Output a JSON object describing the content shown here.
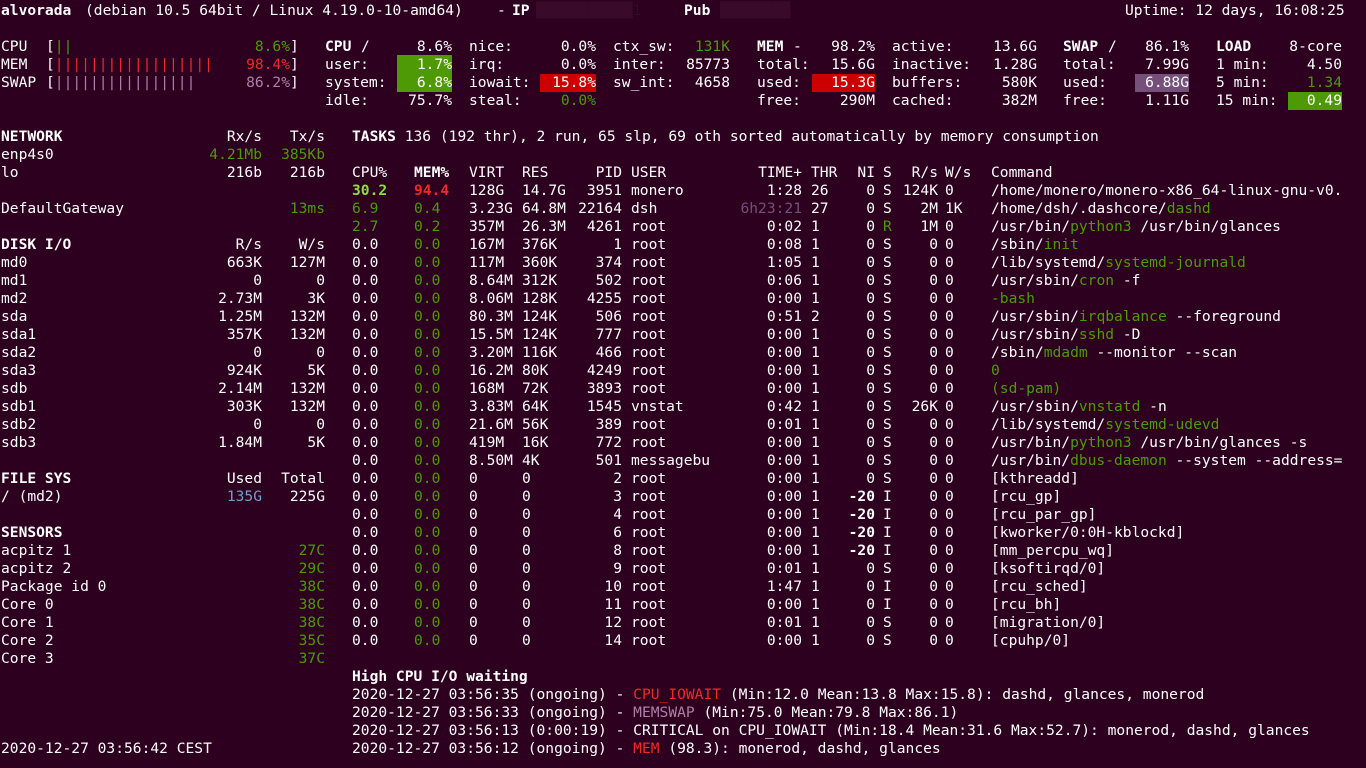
{
  "header": {
    "host": "alvorada",
    "sys": "(debian 10.5 64bit / Linux 4.19.0-10-amd64)",
    "ip_label": "IP",
    "ip_redacted": "███████████1",
    "pub_label": "Pub",
    "pub_redacted": "████████",
    "uptime": "Uptime: 12 days, 16:08:25"
  },
  "quicklook": {
    "cpu": {
      "label": "CPU",
      "bar": "||",
      "pct": "8.6%"
    },
    "mem": {
      "label": "MEM",
      "bar": "||||||||||||||||||",
      "pct": "98.4%"
    },
    "swap": {
      "label": "SWAP",
      "bar": "||||||||||||||||",
      "pct": "86.2%"
    }
  },
  "cpu": {
    "title": "CPU",
    "slash": "/",
    "total": "8.6%",
    "user": "user:",
    "user_v": "1.7%",
    "system": "system:",
    "system_v": "6.8%",
    "idle": "idle:",
    "idle_v": "75.7%",
    "nice": "nice:",
    "nice_v": "0.0%",
    "irq": "irq:",
    "irq_v": "0.0%",
    "iowait": "iowait:",
    "iowait_v": "15.8%",
    "steal": "steal:",
    "steal_v": "0.0%",
    "ctx_sw": "ctx_sw:",
    "ctx_sw_v": "131K",
    "inter": "inter:",
    "inter_v": "85773",
    "sw_int": "sw_int:",
    "sw_int_v": "4658"
  },
  "mem": {
    "title": "MEM",
    "dash": "-",
    "pct": "98.2%",
    "total": "total:",
    "total_v": "15.6G",
    "used": "used:",
    "used_v": "15.3G",
    "free": "free:",
    "free_v": "290M",
    "active": "active:",
    "active_v": "13.6G",
    "inactive": "inactive:",
    "inactive_v": "1.28G",
    "buffers": "buffers:",
    "buffers_v": "580K",
    "cached": "cached:",
    "cached_v": "382M"
  },
  "swap": {
    "title": "SWAP",
    "slash": "/",
    "pct": "86.1%",
    "total": "total:",
    "total_v": "7.99G",
    "used": "used:",
    "used_v": "6.88G",
    "free": "free:",
    "free_v": "1.11G"
  },
  "load": {
    "title": "LOAD",
    "cores": "8-core",
    "m1": "1 min:",
    "m1_v": "4.50",
    "m5": "5 min:",
    "m5_v": "1.34",
    "m15": "15 min:",
    "m15_v": "0.49"
  },
  "network": {
    "title": "NETWORK",
    "rx": "Rx/s",
    "tx": "Tx/s",
    "rows": [
      {
        "name": "enp4s0",
        "rx": "4.21Mb",
        "tx": "385Kb"
      },
      {
        "name": "lo",
        "rx": "216b",
        "tx": "216b"
      }
    ],
    "gw": "DefaultGateway",
    "gw_v": "13ms"
  },
  "disk": {
    "title": "DISK I/O",
    "r": "R/s",
    "w": "W/s",
    "rows": [
      {
        "name": "md0",
        "r": "663K",
        "w": "127M"
      },
      {
        "name": "md1",
        "r": "0",
        "w": "0"
      },
      {
        "name": "md2",
        "r": "2.73M",
        "w": "3K"
      },
      {
        "name": "sda",
        "r": "1.25M",
        "w": "132M"
      },
      {
        "name": "sda1",
        "r": "357K",
        "w": "132M"
      },
      {
        "name": "sda2",
        "r": "0",
        "w": "0"
      },
      {
        "name": "sda3",
        "r": "924K",
        "w": "5K"
      },
      {
        "name": "sdb",
        "r": "2.14M",
        "w": "132M"
      },
      {
        "name": "sdb1",
        "r": "303K",
        "w": "132M"
      },
      {
        "name": "sdb2",
        "r": "0",
        "w": "0"
      },
      {
        "name": "sdb3",
        "r": "1.84M",
        "w": "5K"
      }
    ]
  },
  "fs": {
    "title": "FILE SYS",
    "used": "Used",
    "total": "Total",
    "name": "/ (md2)",
    "used_v": "135G",
    "total_v": "225G"
  },
  "sensors": {
    "title": "SENSORS",
    "rows": [
      {
        "name": "acpitz 1",
        "v": "27C"
      },
      {
        "name": "acpitz 2",
        "v": "29C"
      },
      {
        "name": "Package id 0",
        "v": "38C"
      },
      {
        "name": "Core 0",
        "v": "38C"
      },
      {
        "name": "Core 1",
        "v": "38C"
      },
      {
        "name": "Core 2",
        "v": "35C"
      },
      {
        "name": "Core 3",
        "v": "37C"
      }
    ]
  },
  "datetime": "2020-12-27 03:56:42 CEST",
  "tasks": {
    "label": "TASKS",
    "summary": "136 (192 thr), 2 run, 65 slp, 69 oth sorted automatically by memory consumption"
  },
  "proc": {
    "headers": {
      "cpu": "CPU%",
      "mem": "MEM%",
      "virt": "VIRT",
      "res": "RES",
      "pid": "PID",
      "user": "USER",
      "time": "TIME+",
      "thr": "THR",
      "ni": "NI",
      "s": "S",
      "r": "R/s",
      "w": "W/s",
      "cmd": "Command"
    },
    "rows": [
      {
        "cpu": "30.2",
        "mem": "94.4",
        "virt": "128G",
        "res": "14.7G",
        "pid": "3951",
        "user": "monero",
        "time": "1:28",
        "thr": "26",
        "ni": "0",
        "s": "S",
        "r": "124K",
        "w": "0",
        "cmd_a": "/home/monero/monero-x86_64-linux-gnu-v0.",
        "cmd_b": "",
        "cmd_c": ""
      },
      {
        "cpu": "6.9",
        "mem": "0.4",
        "virt": "3.23G",
        "res": "64.8M",
        "pid": "22164",
        "user": "dsh",
        "time": "6h23:21",
        "thr": "27",
        "ni": "0",
        "s": "S",
        "r": "2M",
        "w": "1K",
        "cmd_a": "/home/dsh/.dashcore/",
        "cmd_b": "dashd",
        "cmd_c": ""
      },
      {
        "cpu": "2.7",
        "mem": "0.2",
        "virt": "357M",
        "res": "26.3M",
        "pid": "4261",
        "user": "root",
        "time": "0:02",
        "thr": "1",
        "ni": "0",
        "s": "R",
        "r": "1M",
        "w": "0",
        "cmd_a": "/usr/bin/",
        "cmd_b": "python3",
        "cmd_c": " /usr/bin/glances"
      },
      {
        "cpu": "0.0",
        "mem": "0.0",
        "virt": "167M",
        "res": "376K",
        "pid": "1",
        "user": "root",
        "time": "0:08",
        "thr": "1",
        "ni": "0",
        "s": "S",
        "r": "0",
        "w": "0",
        "cmd_a": "/sbin/",
        "cmd_b": "init",
        "cmd_c": ""
      },
      {
        "cpu": "0.0",
        "mem": "0.0",
        "virt": "117M",
        "res": "360K",
        "pid": "374",
        "user": "root",
        "time": "1:05",
        "thr": "1",
        "ni": "0",
        "s": "S",
        "r": "0",
        "w": "0",
        "cmd_a": "/lib/systemd/",
        "cmd_b": "systemd-journald",
        "cmd_c": ""
      },
      {
        "cpu": "0.0",
        "mem": "0.0",
        "virt": "8.64M",
        "res": "312K",
        "pid": "502",
        "user": "root",
        "time": "0:06",
        "thr": "1",
        "ni": "0",
        "s": "S",
        "r": "0",
        "w": "0",
        "cmd_a": "/usr/sbin/",
        "cmd_b": "cron",
        "cmd_c": " -f"
      },
      {
        "cpu": "0.0",
        "mem": "0.0",
        "virt": "8.06M",
        "res": "128K",
        "pid": "4255",
        "user": "root",
        "time": "0:00",
        "thr": "1",
        "ni": "0",
        "s": "S",
        "r": "0",
        "w": "0",
        "cmd_a": "",
        "cmd_b": "-bash",
        "cmd_c": ""
      },
      {
        "cpu": "0.0",
        "mem": "0.0",
        "virt": "80.3M",
        "res": "124K",
        "pid": "506",
        "user": "root",
        "time": "0:51",
        "thr": "2",
        "ni": "0",
        "s": "S",
        "r": "0",
        "w": "0",
        "cmd_a": "/usr/sbin/",
        "cmd_b": "irqbalance",
        "cmd_c": " --foreground"
      },
      {
        "cpu": "0.0",
        "mem": "0.0",
        "virt": "15.5M",
        "res": "124K",
        "pid": "777",
        "user": "root",
        "time": "0:00",
        "thr": "1",
        "ni": "0",
        "s": "S",
        "r": "0",
        "w": "0",
        "cmd_a": "/usr/sbin/",
        "cmd_b": "sshd",
        "cmd_c": " -D"
      },
      {
        "cpu": "0.0",
        "mem": "0.0",
        "virt": "3.20M",
        "res": "116K",
        "pid": "466",
        "user": "root",
        "time": "0:00",
        "thr": "1",
        "ni": "0",
        "s": "S",
        "r": "0",
        "w": "0",
        "cmd_a": "/sbin/",
        "cmd_b": "mdadm",
        "cmd_c": " --monitor --scan"
      },
      {
        "cpu": "0.0",
        "mem": "0.0",
        "virt": "16.2M",
        "res": "80K",
        "pid": "4249",
        "user": "root",
        "time": "0:00",
        "thr": "1",
        "ni": "0",
        "s": "S",
        "r": "0",
        "w": "0",
        "cmd_a": "",
        "cmd_b": "0",
        "cmd_c": ""
      },
      {
        "cpu": "0.0",
        "mem": "0.0",
        "virt": "168M",
        "res": "72K",
        "pid": "3893",
        "user": "root",
        "time": "0:00",
        "thr": "1",
        "ni": "0",
        "s": "S",
        "r": "0",
        "w": "0",
        "cmd_a": "",
        "cmd_b": "(sd-pam)",
        "cmd_c": ""
      },
      {
        "cpu": "0.0",
        "mem": "0.0",
        "virt": "3.83M",
        "res": "64K",
        "pid": "1545",
        "user": "vnstat",
        "time": "0:42",
        "thr": "1",
        "ni": "0",
        "s": "S",
        "r": "26K",
        "w": "0",
        "cmd_a": "/usr/sbin/",
        "cmd_b": "vnstatd",
        "cmd_c": " -n"
      },
      {
        "cpu": "0.0",
        "mem": "0.0",
        "virt": "21.6M",
        "res": "56K",
        "pid": "389",
        "user": "root",
        "time": "0:01",
        "thr": "1",
        "ni": "0",
        "s": "S",
        "r": "0",
        "w": "0",
        "cmd_a": "/lib/systemd/",
        "cmd_b": "systemd-udevd",
        "cmd_c": ""
      },
      {
        "cpu": "0.0",
        "mem": "0.0",
        "virt": "419M",
        "res": "16K",
        "pid": "772",
        "user": "root",
        "time": "0:00",
        "thr": "1",
        "ni": "0",
        "s": "S",
        "r": "0",
        "w": "0",
        "cmd_a": "/usr/bin/",
        "cmd_b": "python3",
        "cmd_c": " /usr/bin/glances -s"
      },
      {
        "cpu": "0.0",
        "mem": "0.0",
        "virt": "8.50M",
        "res": "4K",
        "pid": "501",
        "user": "messagebu",
        "time": "0:00",
        "thr": "1",
        "ni": "0",
        "s": "S",
        "r": "0",
        "w": "0",
        "cmd_a": "/usr/bin/",
        "cmd_b": "dbus-daemon",
        "cmd_c": " --system --address="
      },
      {
        "cpu": "0.0",
        "mem": "0.0",
        "virt": "0",
        "res": "0",
        "pid": "2",
        "user": "root",
        "time": "0:00",
        "thr": "1",
        "ni": "0",
        "s": "S",
        "r": "0",
        "w": "0",
        "cmd_a": "[kthreadd]",
        "cmd_b": "",
        "cmd_c": ""
      },
      {
        "cpu": "0.0",
        "mem": "0.0",
        "virt": "0",
        "res": "0",
        "pid": "3",
        "user": "root",
        "time": "0:00",
        "thr": "1",
        "ni": "-20",
        "s": "I",
        "r": "0",
        "w": "0",
        "cmd_a": "[rcu_gp]",
        "cmd_b": "",
        "cmd_c": ""
      },
      {
        "cpu": "0.0",
        "mem": "0.0",
        "virt": "0",
        "res": "0",
        "pid": "4",
        "user": "root",
        "time": "0:00",
        "thr": "1",
        "ni": "-20",
        "s": "I",
        "r": "0",
        "w": "0",
        "cmd_a": "[rcu_par_gp]",
        "cmd_b": "",
        "cmd_c": ""
      },
      {
        "cpu": "0.0",
        "mem": "0.0",
        "virt": "0",
        "res": "0",
        "pid": "6",
        "user": "root",
        "time": "0:00",
        "thr": "1",
        "ni": "-20",
        "s": "I",
        "r": "0",
        "w": "0",
        "cmd_a": "[kworker/0:0H-kblockd]",
        "cmd_b": "",
        "cmd_c": ""
      },
      {
        "cpu": "0.0",
        "mem": "0.0",
        "virt": "0",
        "res": "0",
        "pid": "8",
        "user": "root",
        "time": "0:00",
        "thr": "1",
        "ni": "-20",
        "s": "I",
        "r": "0",
        "w": "0",
        "cmd_a": "[mm_percpu_wq]",
        "cmd_b": "",
        "cmd_c": ""
      },
      {
        "cpu": "0.0",
        "mem": "0.0",
        "virt": "0",
        "res": "0",
        "pid": "9",
        "user": "root",
        "time": "0:01",
        "thr": "1",
        "ni": "0",
        "s": "S",
        "r": "0",
        "w": "0",
        "cmd_a": "[ksoftirqd/0]",
        "cmd_b": "",
        "cmd_c": ""
      },
      {
        "cpu": "0.0",
        "mem": "0.0",
        "virt": "0",
        "res": "0",
        "pid": "10",
        "user": "root",
        "time": "1:47",
        "thr": "1",
        "ni": "0",
        "s": "I",
        "r": "0",
        "w": "0",
        "cmd_a": "[rcu_sched]",
        "cmd_b": "",
        "cmd_c": ""
      },
      {
        "cpu": "0.0",
        "mem": "0.0",
        "virt": "0",
        "res": "0",
        "pid": "11",
        "user": "root",
        "time": "0:00",
        "thr": "1",
        "ni": "0",
        "s": "I",
        "r": "0",
        "w": "0",
        "cmd_a": "[rcu_bh]",
        "cmd_b": "",
        "cmd_c": ""
      },
      {
        "cpu": "0.0",
        "mem": "0.0",
        "virt": "0",
        "res": "0",
        "pid": "12",
        "user": "root",
        "time": "0:01",
        "thr": "1",
        "ni": "0",
        "s": "S",
        "r": "0",
        "w": "0",
        "cmd_a": "[migration/0]",
        "cmd_b": "",
        "cmd_c": ""
      },
      {
        "cpu": "0.0",
        "mem": "0.0",
        "virt": "0",
        "res": "0",
        "pid": "14",
        "user": "root",
        "time": "0:00",
        "thr": "1",
        "ni": "0",
        "s": "S",
        "r": "0",
        "w": "0",
        "cmd_a": "[cpuhp/0]",
        "cmd_b": "",
        "cmd_c": ""
      }
    ]
  },
  "alerts": {
    "title": "High CPU I/O waiting",
    "rows": [
      {
        "pre": "2020-12-27 03:56:35 (ongoing) - ",
        "key": "CPU_IOWAIT",
        "post": " (Min:12.0 Mean:13.8 Max:15.8): dashd, glances, monerod"
      },
      {
        "pre": "2020-12-27 03:56:33 (ongoing) - ",
        "key": "MEMSWAP",
        "post": " (Min:75.0 Mean:79.8 Max:86.1)"
      },
      {
        "pre": "2020-12-27 03:56:13 (0:00:19) - ",
        "key": "CRITICAL on CPU_IOWAIT",
        "post": " (Min:18.4 Mean:31.6 Max:52.7): monerod, dashd, glances"
      },
      {
        "pre": "2020-12-27 03:56:12 (ongoing) - ",
        "key": "MEM",
        "post": " (98.3): monerod, dashd, glances"
      }
    ]
  }
}
